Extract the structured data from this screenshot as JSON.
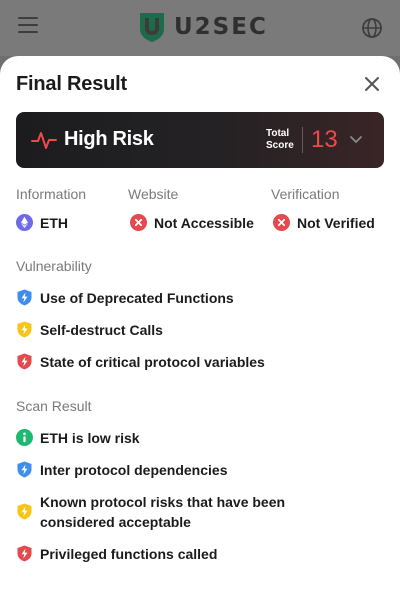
{
  "header": {
    "brand": "U2SEC",
    "icons": [
      "hamburger-menu-icon",
      "shield-logo-icon",
      "globe-icon"
    ]
  },
  "result": {
    "title": "Final Result",
    "close_icon": "close-icon",
    "risk_level": "High Risk",
    "score_caption_line1": "Total",
    "score_caption_line2": "Score",
    "score_value": "13",
    "accent_color": "#ef4a4a"
  },
  "info": {
    "information_label": "Information",
    "information_value": "ETH",
    "website_label": "Website",
    "website_value": "Not Accessible",
    "verification_label": "Verification",
    "verification_value": "Not Verified"
  },
  "vulnerability": {
    "label": "Vulnerability",
    "items": [
      {
        "text": "Use of Deprecated Functions",
        "level": "blue",
        "icon": "bolt-shield-icon"
      },
      {
        "text": "Self-destruct Calls",
        "level": "yellow",
        "icon": "bolt-shield-icon"
      },
      {
        "text": "State of critical protocol variables",
        "level": "red",
        "icon": "bolt-shield-icon"
      }
    ]
  },
  "scan": {
    "label": "Scan Result",
    "items": [
      {
        "text": "ETH is low risk",
        "level": "green",
        "icon": "info-icon"
      },
      {
        "text": "Inter protocol dependencies",
        "level": "blue",
        "icon": "bolt-shield-icon"
      },
      {
        "text": "Known protocol risks that have been considered acceptable",
        "level": "yellow",
        "icon": "bolt-shield-icon"
      },
      {
        "text": "Privileged functions called",
        "level": "red",
        "icon": "bolt-shield-icon"
      }
    ]
  },
  "colors": {
    "blue": "#3d8ef0",
    "yellow": "#f5c518",
    "red": "#e5484d",
    "green": "#1fb873",
    "eth": "#6f6ae8"
  }
}
